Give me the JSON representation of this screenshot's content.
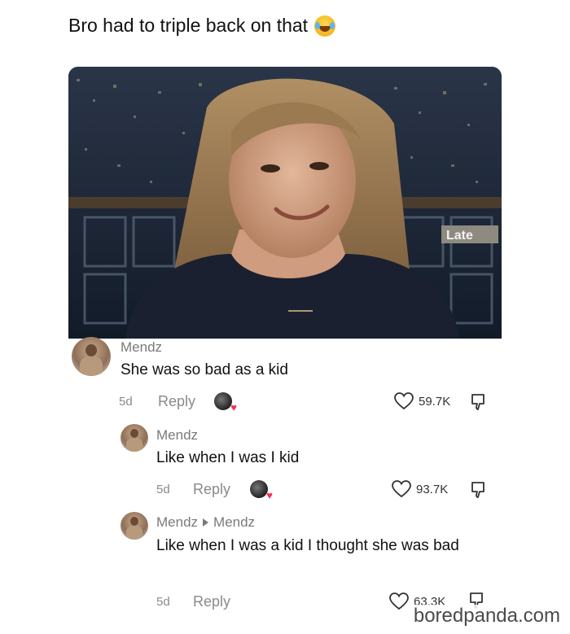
{
  "post": {
    "title": "Bro had to triple back on that",
    "emoji_icon": "laughing-tears-emoji"
  },
  "photo": {
    "overlay_text": "Late"
  },
  "comments": [
    {
      "username": "Mendz",
      "text": "She was so bad as a kid",
      "time": "5d",
      "reply_label": "Reply",
      "likes": "59.7K"
    },
    {
      "username": "Mendz",
      "text": "Like when I was I kid",
      "time": "5d",
      "reply_label": "Reply",
      "likes": "93.7K"
    },
    {
      "username": "Mendz",
      "reply_to": "Mendz",
      "text": "Like when I was a kid I thought she was bad",
      "time": "5d",
      "reply_label": "Reply",
      "likes": "63.3K"
    }
  ],
  "watermark": "boredpanda.com",
  "colors": {
    "accent_heart": "#fe2c55",
    "meta_gray": "#8a8a8a"
  }
}
